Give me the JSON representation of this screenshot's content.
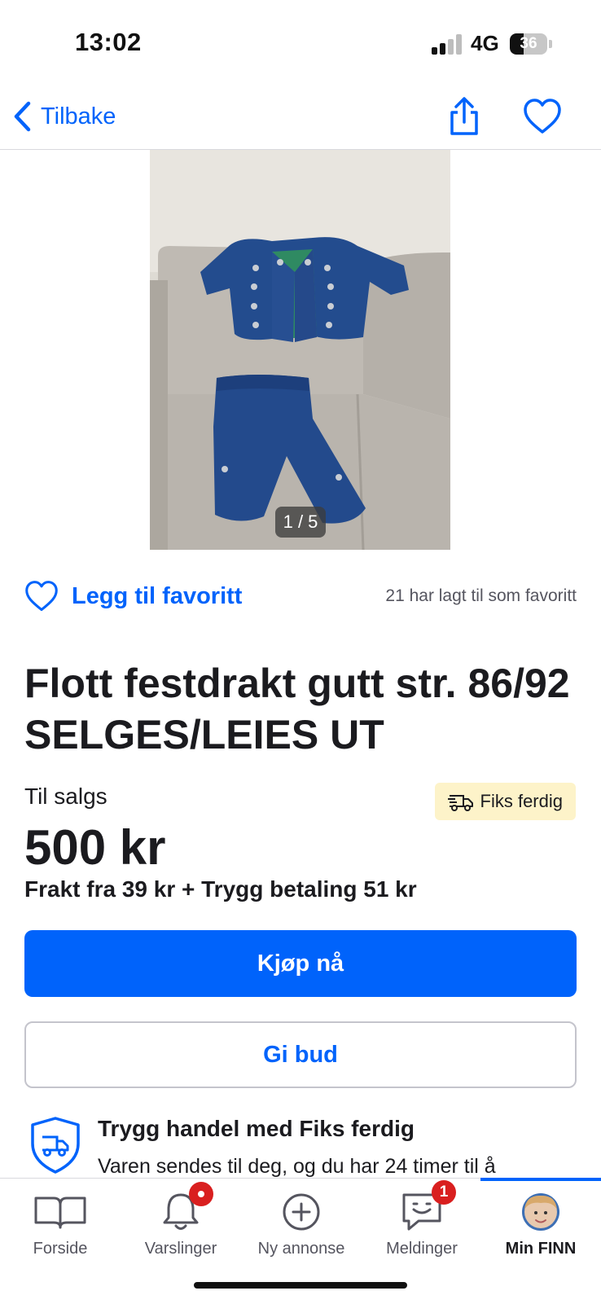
{
  "status_bar": {
    "time": "13:02",
    "network": "4G",
    "battery": "36",
    "battery_level": 0.36
  },
  "nav": {
    "back_label": "Tilbake",
    "share_icon": "share-icon",
    "favorite_icon": "heart-icon"
  },
  "gallery": {
    "counter": "1 / 5"
  },
  "favorite": {
    "label": "Legg til favoritt",
    "count_text": "21 har lagt til som favoritt"
  },
  "listing": {
    "title": "Flott festdrakt gutt str. 86/92    SELGES/LEIES UT",
    "sale_label": "Til salgs",
    "badge_label": "Fiks ferdig",
    "price": "500 kr",
    "shipping": "Frakt fra 39 kr + Trygg betaling 51 kr"
  },
  "actions": {
    "buy_label": "Kjøp nå",
    "bid_label": "Gi bud"
  },
  "trygg": {
    "title": "Trygg handel med Fiks ferdig",
    "text": "Varen sendes til deg, og du har 24 timer til å"
  },
  "tabs": [
    {
      "label": "Forside",
      "icon": "book-icon"
    },
    {
      "label": "Varslinger",
      "icon": "bell-icon"
    },
    {
      "label": "Ny annonse",
      "icon": "plus-circle-icon"
    },
    {
      "label": "Meldinger",
      "icon": "chat-icon",
      "badge": "1"
    },
    {
      "label": "Min FINN",
      "icon": "avatar",
      "active": true
    }
  ],
  "colors": {
    "accent": "#0063fb",
    "badge": "#d91f1f",
    "fiks_badge_bg": "#fdf3c9"
  }
}
